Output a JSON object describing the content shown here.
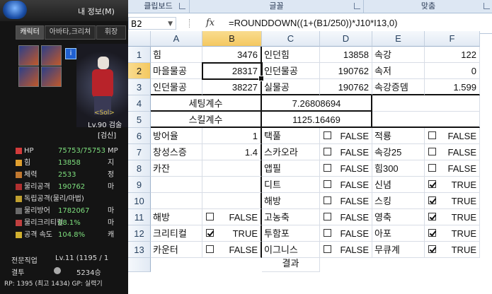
{
  "game": {
    "window_title": "내 정보(M)",
    "tabs": [
      "캐릭터",
      "아바타,크리쳐",
      "휘장"
    ],
    "info_icon": "i",
    "server_tag": "<Sol>",
    "level_line": "Lv.90 검술",
    "job_line": "[검신]",
    "stats": [
      {
        "label": "HP",
        "value": "75753/75753",
        "right": "MP",
        "icon_color": "#d23b3b"
      },
      {
        "label": "힘",
        "value": "13858",
        "right": "지",
        "icon_color": "#e0a030"
      },
      {
        "label": "체력",
        "value": "2533",
        "right": "정",
        "icon_color": "#c07830"
      },
      {
        "label": "물리공격",
        "value": "190762",
        "right": "마",
        "icon_color": "#b03030"
      },
      {
        "label": "독립공격(물리/마법)",
        "value": "",
        "right": "",
        "icon_color": "#c0a030"
      },
      {
        "label": "물리방어",
        "value": "1782067",
        "right": "마",
        "icon_color": "#6a6a6a"
      },
      {
        "label": "물리크리티컬",
        "value": "68.1%",
        "right": "마",
        "icon_color": "#c04040"
      },
      {
        "label": "공격 속도",
        "value": "104.8%",
        "right": "캐",
        "icon_color": "#d0b030"
      }
    ],
    "expert_label": "전문직업",
    "expert_value": "Lv.11 (1195 / 1",
    "duel_label": "결투",
    "duel_value": "5234승",
    "rp_line": "RP: 1395 (최고 1434)  GP: 실력기"
  },
  "ribbon": {
    "groups": [
      "클립보드",
      "글꼴",
      "맞춤"
    ]
  },
  "formula_bar": {
    "name_box": "B2",
    "fx_label": "fx",
    "formula": "=ROUNDDOWN((1+(B1/250))*J10*I13,0)"
  },
  "sheet": {
    "columns": [
      "A",
      "B",
      "C",
      "D",
      "E",
      "F"
    ],
    "selected_column": "B",
    "rows": [
      "1",
      "2",
      "3",
      "4",
      "5",
      "6",
      "7",
      "8",
      "9",
      "10",
      "11",
      "12",
      "13"
    ],
    "selected_row": "2",
    "r1": {
      "A": "힘",
      "B": "3476",
      "C": "인던힘",
      "D": "13858",
      "E": "속강",
      "F": "122"
    },
    "r2": {
      "A": "마을물공",
      "B": "28317",
      "C": "인던물공",
      "D": "190762",
      "E": "속저",
      "F": "0"
    },
    "r3": {
      "A": "인던물공",
      "B": "38227",
      "C": "실물공",
      "D": "190762",
      "E": "속강증뎀",
      "F": "1.599"
    },
    "r4": {
      "label": "세팅계수",
      "value": "7.26808694"
    },
    "r5": {
      "label": "스킬계수",
      "value": "1125.16469"
    },
    "r6": {
      "A": "방어율",
      "B": "1",
      "C": "택풀",
      "D": "FALSE",
      "E": "적룡",
      "F": "FALSE"
    },
    "r7": {
      "A": "창성스증",
      "B": "1.4",
      "C": "스카오라",
      "D": "FALSE",
      "E": "속강25",
      "F": "FALSE"
    },
    "r8": {
      "A": "카잔",
      "B": "",
      "C": "앱필",
      "D": "FALSE",
      "E": "힘300",
      "F": "FALSE"
    },
    "r9": {
      "A": "",
      "B": "",
      "C": "디트",
      "D": "FALSE",
      "E": "신념",
      "F": "TRUE"
    },
    "r10": {
      "A": "",
      "B": "",
      "C": "해방",
      "D": "FALSE",
      "E": "스킹",
      "F": "TRUE"
    },
    "r11": {
      "A": "해방",
      "B": "FALSE",
      "C": "고농축",
      "D": "FALSE",
      "E": "영축",
      "F": "TRUE"
    },
    "r12": {
      "A": "크리티컬",
      "B": "TRUE",
      "C": "투함포",
      "D": "FALSE",
      "E": "아포",
      "F": "TRUE"
    },
    "r13": {
      "A": "카운터",
      "B": "FALSE",
      "C": "이그니스",
      "D": "FALSE",
      "E": "무큐계",
      "F": "TRUE"
    },
    "r14_partial": {
      "C": "결과"
    }
  },
  "colors": {
    "header_selected": "#f4c860",
    "header_bg": "#e2eaf4",
    "ribbon_bg": "#dde7f3"
  }
}
